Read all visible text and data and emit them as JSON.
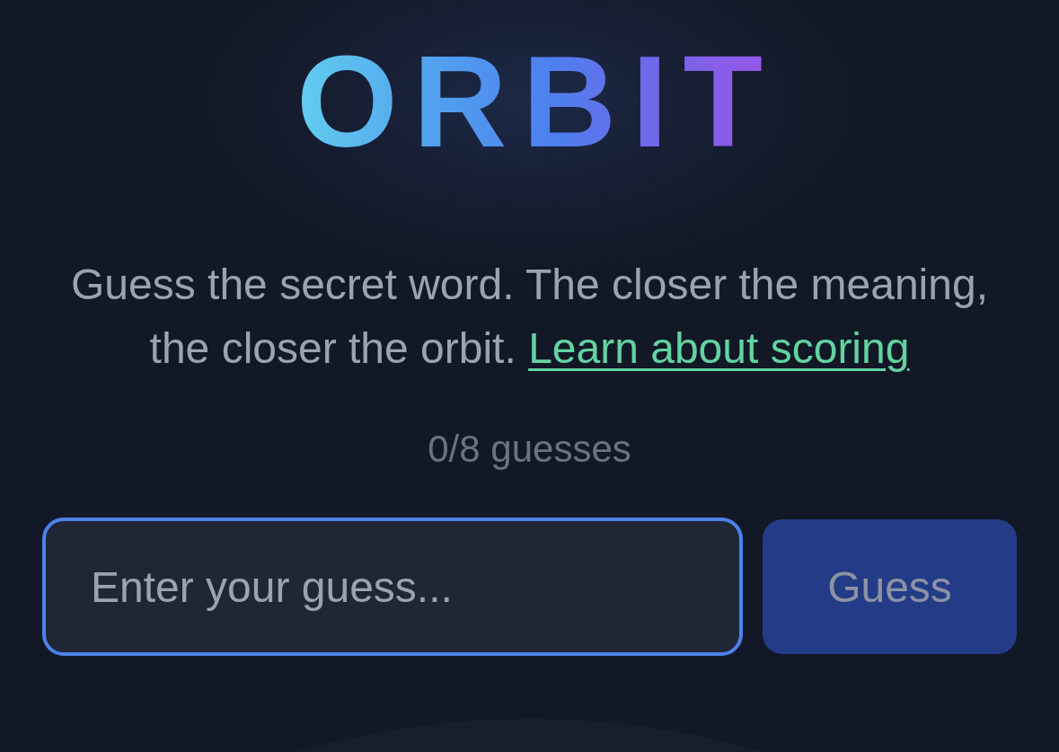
{
  "logo": {
    "text": "ORBIT"
  },
  "intro": {
    "text": "Guess the secret word. The closer the meaning, the closer the orbit.",
    "link": "Learn about scoring"
  },
  "guess_counter": "0/8 guesses",
  "guess_input": {
    "placeholder": "Enter your guess...",
    "focused": true
  },
  "guess_button": {
    "label": "Guess",
    "disabled": true
  }
}
